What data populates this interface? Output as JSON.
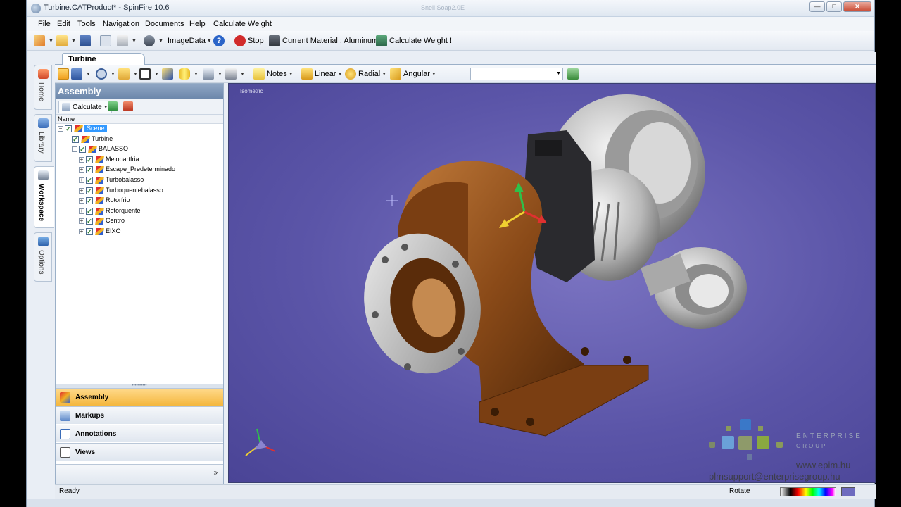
{
  "window": {
    "title": "Turbine.CATProduct* - SpinFire 10.6",
    "ghost_title": "Snell Soap2.0E"
  },
  "menu": [
    "File",
    "Edit",
    "Tools",
    "Navigation",
    "Documents",
    "Help",
    "Calculate Weight"
  ],
  "toolbar1": {
    "imagedata": "ImageData",
    "stop": "Stop",
    "material": "Current Material : Aluminum",
    "calc_weight": "Calculate Weight !"
  },
  "tab": "Turbine",
  "toolbar2": {
    "notes": "Notes",
    "linear": "Linear",
    "radial": "Radial",
    "angular": "Angular"
  },
  "side_tabs": [
    "Home",
    "Library",
    "Workspace",
    "Options"
  ],
  "panel": {
    "title": "Assembly",
    "calculate": "Calculate",
    "column": "Name",
    "tree": [
      {
        "label": "Scene",
        "level": 0,
        "selected": true
      },
      {
        "label": "Turbine",
        "level": 1
      },
      {
        "label": "BALASSO",
        "level": 2
      },
      {
        "label": "Meiopartfria",
        "level": 3
      },
      {
        "label": "Escape_Predeterminado",
        "level": 3
      },
      {
        "label": "Turbobalasso",
        "level": 3
      },
      {
        "label": "Turboquentebalasso",
        "level": 3
      },
      {
        "label": "Rotorfrio",
        "level": 3
      },
      {
        "label": "Rotorquente",
        "level": 3
      },
      {
        "label": "Centro",
        "level": 3
      },
      {
        "label": "EIXO",
        "level": 3
      }
    ],
    "nav": [
      "Assembly",
      "Markups",
      "Annotations",
      "Views"
    ]
  },
  "viewport": {
    "label": "Isometric",
    "logo": "ENTERPRISE",
    "logo_sub": "GROUP",
    "web": "www.epim.hu",
    "mail": "plmsupport@enterprisegroup.hu"
  },
  "status": {
    "ready": "Ready",
    "mode": "Rotate"
  },
  "colors": {
    "accent": "#f4b73e",
    "viewport": "#5b55a8",
    "housing": "#8a4a18",
    "compressor": "#c9c9c9"
  }
}
